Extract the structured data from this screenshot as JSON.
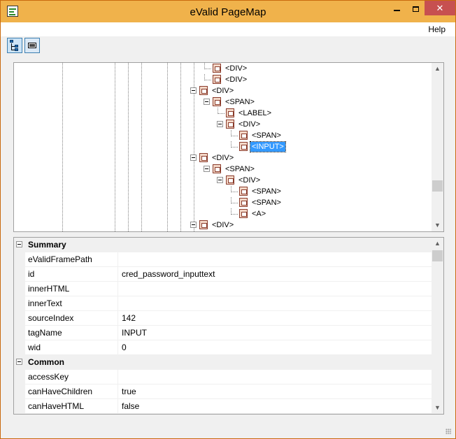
{
  "window": {
    "title": "eValid PageMap",
    "controls": {
      "close_glyph": "✕"
    }
  },
  "menu": {
    "help": "Help"
  },
  "toolbar": {
    "buttons": [
      {
        "name": "tree-view-icon",
        "pressed": true
      },
      {
        "name": "memory-icon",
        "pressed": false
      }
    ]
  },
  "tree": {
    "nodes": [
      {
        "label": "<DIV>",
        "level": 5
      },
      {
        "label": "<DIV>",
        "level": 5
      },
      {
        "label": "<DIV>",
        "level": 4
      },
      {
        "label": "<SPAN>",
        "level": 5
      },
      {
        "label": "<LABEL>",
        "level": 6
      },
      {
        "label": "<DIV>",
        "level": 6
      },
      {
        "label": "<SPAN>",
        "level": 7
      },
      {
        "label": "<INPUT>",
        "level": 7,
        "selected": true
      },
      {
        "label": "<DIV>",
        "level": 4
      },
      {
        "label": "<SPAN>",
        "level": 5
      },
      {
        "label": "<DIV>",
        "level": 6
      },
      {
        "label": "<SPAN>",
        "level": 7
      },
      {
        "label": "<SPAN>",
        "level": 7
      },
      {
        "label": "<A>",
        "level": 7
      },
      {
        "label": "<DIV>",
        "level": 4
      }
    ],
    "scroll_up": "▲",
    "scroll_down": "▼"
  },
  "properties": {
    "categories": [
      {
        "label": "Summary",
        "rows": [
          {
            "name": "eValidFramePath",
            "value": ""
          },
          {
            "name": "id",
            "value": "cred_password_inputtext"
          },
          {
            "name": "innerHTML",
            "value": ""
          },
          {
            "name": "innerText",
            "value": ""
          },
          {
            "name": "sourceIndex",
            "value": "142"
          },
          {
            "name": "tagName",
            "value": "INPUT"
          },
          {
            "name": "wid",
            "value": "0"
          }
        ]
      },
      {
        "label": "Common",
        "rows": [
          {
            "name": "accessKey",
            "value": ""
          },
          {
            "name": "canHaveChildren",
            "value": "true"
          },
          {
            "name": "canHaveHTML",
            "value": "false"
          }
        ]
      }
    ]
  },
  "colors": {
    "titlebar": "#f0b24b",
    "close_button": "#c75050",
    "selection": "#3399ff"
  }
}
